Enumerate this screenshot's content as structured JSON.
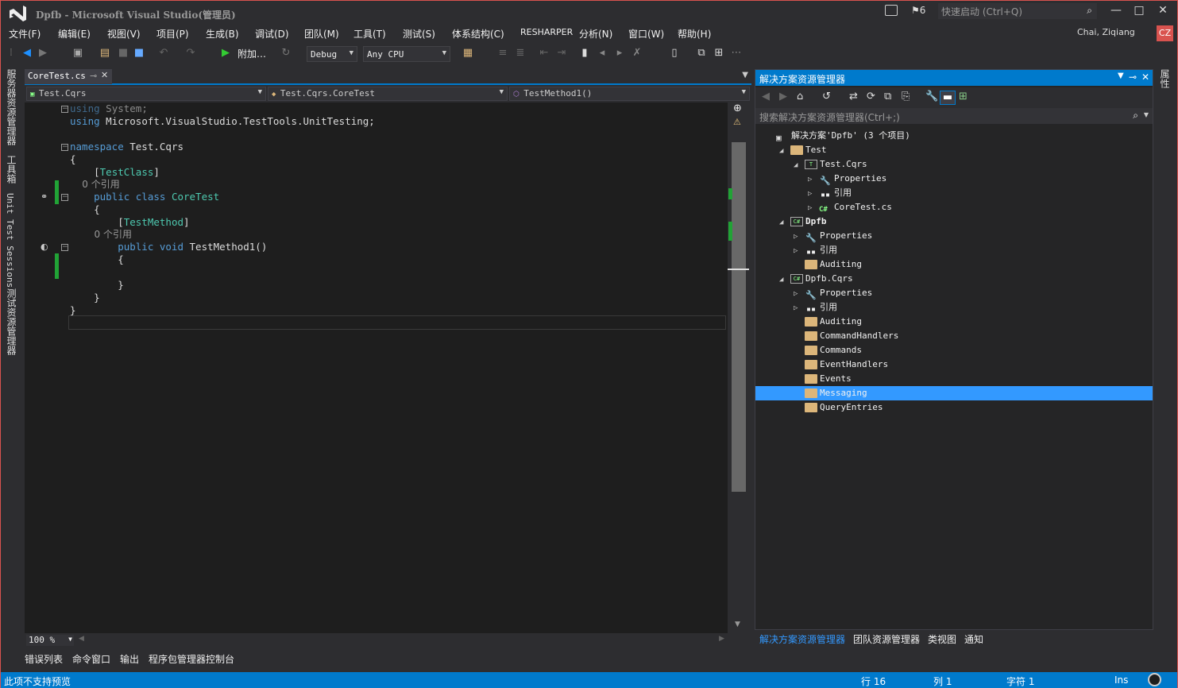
{
  "window": {
    "title": "Dpfb - Microsoft Visual Studio(管理员)",
    "notifications_count": "6",
    "quick_launch_placeholder": "快速启动 (Ctrl+Q)",
    "minimize": "—",
    "maximize": "□",
    "close": "✕"
  },
  "menu": [
    "文件(F)",
    "编辑(E)",
    "视图(V)",
    "项目(P)",
    "生成(B)",
    "调试(D)",
    "团队(M)",
    "工具(T)",
    "测试(S)",
    "体系结构(C)",
    "RESHARPER",
    "分析(N)",
    "窗口(W)",
    "帮助(H)"
  ],
  "user": {
    "name": "Chai, Ziqiang",
    "initials": "CZ"
  },
  "toolbar": {
    "attach_label": "附加…",
    "config": "Debug",
    "platform": "Any CPU"
  },
  "left_strip": [
    "服务器资源管理器",
    "工具箱",
    "Unit Test Sessions",
    "测试资源管理器"
  ],
  "right_strip": [
    "属性"
  ],
  "editor": {
    "tab": "CoreTest.cs",
    "nav": [
      "Test.Cqrs",
      "Test.Cqrs.CoreTest",
      "TestMethod1()"
    ],
    "zoom": "100 %",
    "lines": {
      "l1a": "using",
      "l1b": " System;",
      "l2a": "using",
      "l2b": " Microsoft.VisualStudio.TestTools.UnitTesting;",
      "l4a": "namespace",
      "l4b": " Test.Cqrs",
      "l5": "{",
      "l6a": "    [",
      "l6b": "TestClass",
      "l6c": "]",
      "l6ref": "    0 个引用",
      "l7a": "    public class ",
      "l7b": "CoreTest",
      "l8": "    {",
      "l9a": "        [",
      "l9b": "TestMethod",
      "l9c": "]",
      "l9ref": "        0 个引用",
      "l10a": "        public void",
      "l10b": " TestMethod1()",
      "l11": "        {",
      "l13": "        }",
      "l14": "    }",
      "l15": "}"
    }
  },
  "bottom_tabs": [
    "错误列表",
    "命令窗口",
    "输出",
    "程序包管理器控制台"
  ],
  "status": {
    "message": "此项不支持预览",
    "line": "行 16",
    "col": "列 1",
    "char": "字符 1",
    "mode": "Ins"
  },
  "solution_explorer": {
    "title": "解决方案资源管理器",
    "search_placeholder": "搜索解决方案资源管理器(Ctrl+;)",
    "tree": [
      {
        "label": "解决方案'Dpfb' (3 个项目)",
        "depth": 0,
        "expander": "",
        "icon": "solution"
      },
      {
        "label": "Test",
        "depth": 1,
        "expander": "◢",
        "icon": "folder"
      },
      {
        "label": "Test.Cqrs",
        "depth": 2,
        "expander": "◢",
        "icon": "testproj"
      },
      {
        "label": "Properties",
        "depth": 3,
        "expander": "▷",
        "icon": "wrench"
      },
      {
        "label": "引用",
        "depth": 3,
        "expander": "▷",
        "icon": "refs"
      },
      {
        "label": "CoreTest.cs",
        "depth": 3,
        "expander": "▷",
        "icon": "csfile"
      },
      {
        "label": "Dpfb",
        "depth": 1,
        "expander": "◢",
        "icon": "csproj",
        "bold": true
      },
      {
        "label": "Properties",
        "depth": 2,
        "expander": "▷",
        "icon": "wrench"
      },
      {
        "label": "引用",
        "depth": 2,
        "expander": "▷",
        "icon": "refs"
      },
      {
        "label": "Auditing",
        "depth": 2,
        "expander": "",
        "icon": "folder"
      },
      {
        "label": "Dpfb.Cqrs",
        "depth": 1,
        "expander": "◢",
        "icon": "csproj"
      },
      {
        "label": "Properties",
        "depth": 2,
        "expander": "▷",
        "icon": "wrench"
      },
      {
        "label": "引用",
        "depth": 2,
        "expander": "▷",
        "icon": "refs"
      },
      {
        "label": "Auditing",
        "depth": 2,
        "expander": "",
        "icon": "folder"
      },
      {
        "label": "CommandHandlers",
        "depth": 2,
        "expander": "",
        "icon": "folder"
      },
      {
        "label": "Commands",
        "depth": 2,
        "expander": "",
        "icon": "folder"
      },
      {
        "label": "EventHandlers",
        "depth": 2,
        "expander": "",
        "icon": "folder"
      },
      {
        "label": "Events",
        "depth": 2,
        "expander": "",
        "icon": "folder"
      },
      {
        "label": "Messaging",
        "depth": 2,
        "expander": "",
        "icon": "folder",
        "selected": true
      },
      {
        "label": "QueryEntries",
        "depth": 2,
        "expander": "",
        "icon": "folder"
      }
    ],
    "tabs": [
      "解决方案资源管理器",
      "团队资源管理器",
      "类视图",
      "通知"
    ]
  }
}
